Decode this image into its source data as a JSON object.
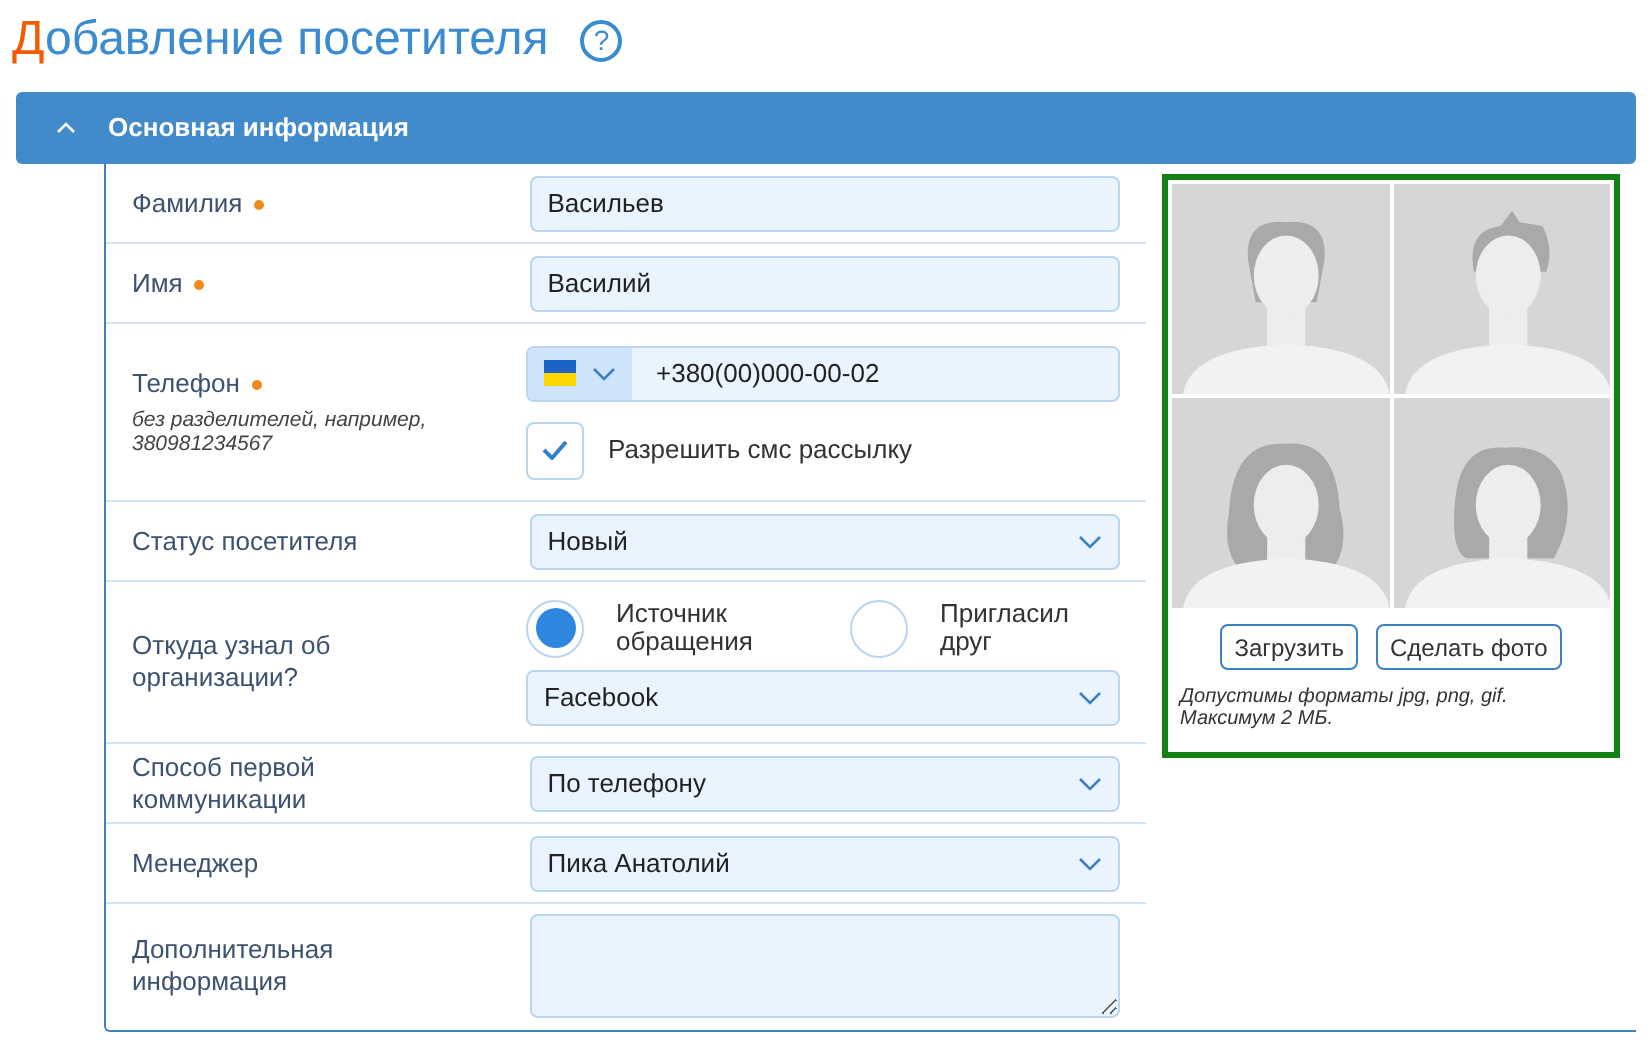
{
  "title": {
    "accent": "Д",
    "text": "обавление посетителя",
    "help": "?"
  },
  "section": {
    "title": "Основная информация",
    "expanded": true
  },
  "fields": [
    {
      "kind": "text",
      "label": "Фамилия",
      "required": true,
      "value": "Васильев"
    },
    {
      "kind": "text",
      "label": "Имя",
      "required": true,
      "value": "Василий"
    },
    {
      "kind": "phone",
      "label": "Телефон",
      "required": true,
      "hint": "без разделителей, например, 380981234567",
      "value": "+380(00)000-00-02",
      "checkbox": {
        "label": "Разрешить смс рассылку",
        "checked": true
      }
    },
    {
      "kind": "select",
      "label": "Статус посетителя",
      "required": false,
      "value": "Новый"
    },
    {
      "kind": "radio_select",
      "label": "Откуда узнал об организации?",
      "required": false,
      "options": [
        {
          "label": "Источник обращения",
          "selected": true
        },
        {
          "label": "Пригласил друг",
          "selected": false
        }
      ],
      "value": "Facebook"
    },
    {
      "kind": "select",
      "label": "Способ первой коммуникации",
      "required": false,
      "value": "По телефону"
    },
    {
      "kind": "select",
      "label": "Менеджер",
      "required": false,
      "value": "Пика Анатолий"
    },
    {
      "kind": "textarea",
      "label": "Дополнительная информация",
      "required": false
    }
  ],
  "photo": {
    "buttons": [
      "Загрузить",
      "Сделать фото"
    ],
    "note": "Допустимы форматы jpg, png, gif. Максимум 2 МБ."
  }
}
